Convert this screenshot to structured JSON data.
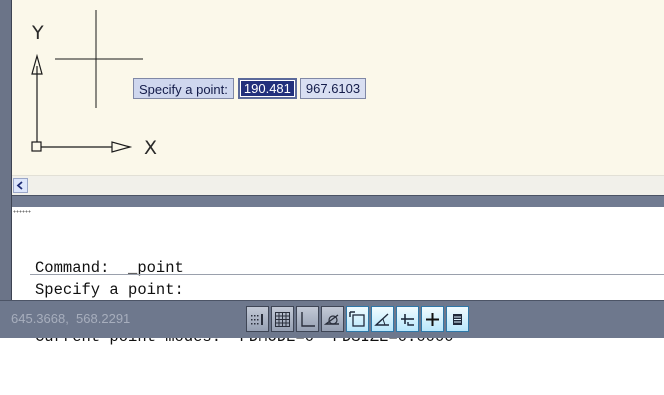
{
  "drawing": {
    "ucs_y_label": "Y",
    "ucs_x_label": "X",
    "background_color": "#fbf8ea",
    "crosshair_icon": "crosshair-cursor-icon"
  },
  "dynamic_input": {
    "prompt": "Specify a point:",
    "x_value": "190.481",
    "y_value": "967.6103"
  },
  "command_line": {
    "history": [
      "Command:  _point",
      "Current point modes:  PDMODE=0  PDSIZE=0.0000"
    ],
    "prompt": "Specify a point:"
  },
  "status_bar": {
    "coordinates": "645.3668,  568.2291",
    "toggles": [
      {
        "name": "snap-icon",
        "on": false
      },
      {
        "name": "grid-icon",
        "on": false
      },
      {
        "name": "ortho-icon",
        "on": false
      },
      {
        "name": "polar-icon",
        "on": false
      },
      {
        "name": "osnap-icon",
        "on": true
      },
      {
        "name": "otrack-icon",
        "on": true
      },
      {
        "name": "ducs-icon",
        "on": true
      },
      {
        "name": "dyn-icon",
        "on": true
      },
      {
        "name": "lineweight-icon",
        "on": true
      }
    ],
    "accent_color": "#b9e7fb"
  }
}
